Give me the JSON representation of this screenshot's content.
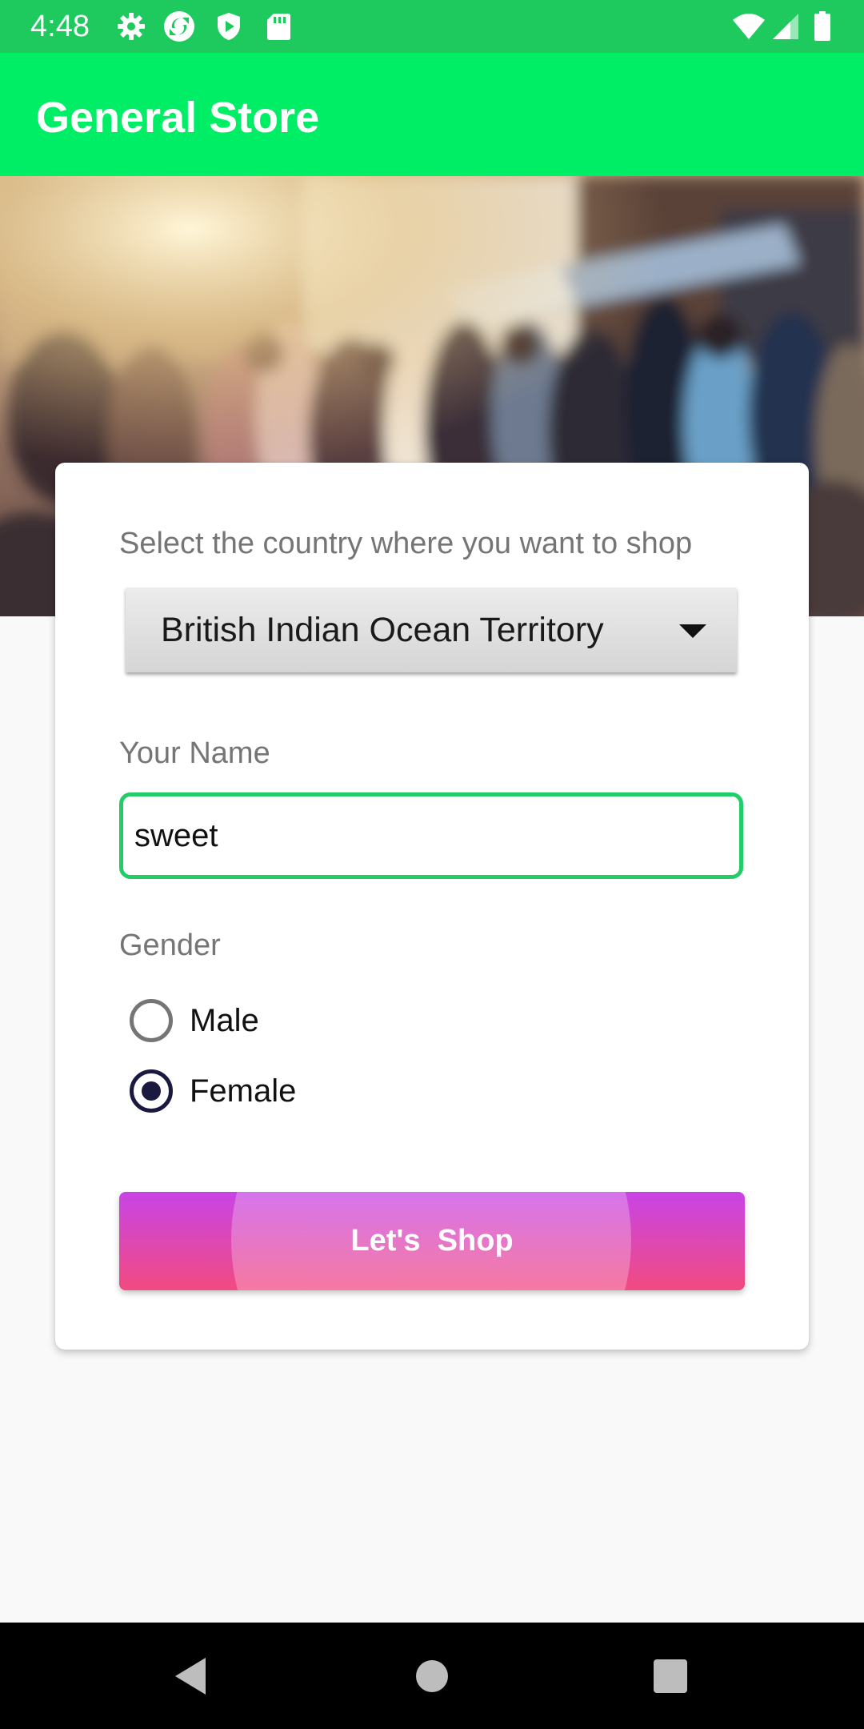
{
  "status_bar": {
    "time": "4:48",
    "left_icons": [
      "gear-icon",
      "sync-icon",
      "shield-play-icon",
      "sd-card-icon"
    ],
    "right_icons": [
      "wifi-icon",
      "cell-signal-icon",
      "battery-icon"
    ]
  },
  "app_bar": {
    "title": "General Store"
  },
  "hero": {
    "description_icon": "street-crowd-image"
  },
  "form": {
    "country_label": "Select the country where you want to shop",
    "country_selected": "British Indian Ocean Territory",
    "name_label": "Your Name",
    "name_value": "sweet",
    "gender_label": "Gender",
    "gender_options": [
      {
        "label": "Male",
        "checked": false
      },
      {
        "label": "Female",
        "checked": true
      }
    ],
    "submit_label": "Let's  Shop"
  },
  "nav_bar": {
    "buttons": [
      "back-icon",
      "home-icon",
      "recents-icon"
    ]
  },
  "colors": {
    "status_bar": "#1ec95d",
    "app_bar": "#00ee66",
    "input_border": "#22cc66",
    "radio_checked": "#1a1a40",
    "button_gradient_top": "#c844e6",
    "button_gradient_bottom": "#f24b80"
  }
}
